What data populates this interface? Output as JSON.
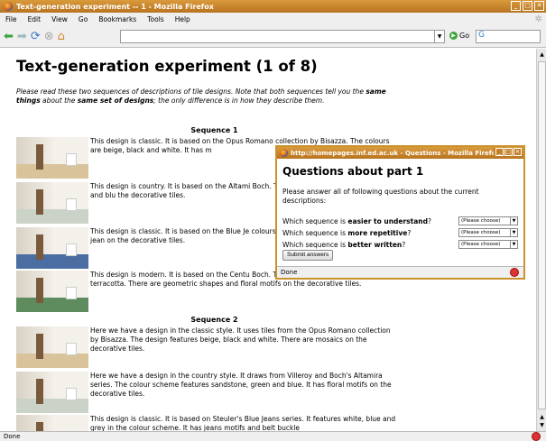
{
  "window": {
    "title": "Text-generation experiment -- 1 - Mozilla Firefox"
  },
  "menu": [
    "File",
    "Edit",
    "View",
    "Go",
    "Bookmarks",
    "Tools",
    "Help"
  ],
  "navbar": {
    "url": "",
    "go_label": "Go",
    "search_placeholder": ""
  },
  "page": {
    "title": "Text-generation experiment (1 of 8)",
    "intro_parts": [
      "Please read these two sequences of descriptions of tile designs. Note that both sequences tell you the ",
      "same things",
      " about the ",
      "same set of designs",
      "; the only difference is in how they describe them."
    ],
    "seq1_heading": "Sequence 1",
    "seq2_heading": "Sequence 2",
    "seq1": [
      "This design is classic. It is based on the Opus Romano collection by Bisazza. The colours are beige, black and white. It has m",
      "This design is country. It is based on the Altami Boch. The colours are sandstone, green and blu the decorative tiles.",
      "This design is classic. It is based on the Blue Je colours are white, blue and grey. There are jean on the decorative tiles.",
      "This design is modern. It is based on the Centu Boch. The colours are blue, white and terracotta. There are geometric shapes and floral motifs on the decorative tiles."
    ],
    "seq2": [
      "Here we have a design in the classic style. It uses tiles from the Opus Romano collection by Bisazza. The design features beige, black and white. There are mosaics on the decorative tiles.",
      "Here we have a design in the country style. It draws from Villeroy and Boch's Altamira series. The colour scheme features sandstone, green and blue. It has floral motifs on the decorative tiles.",
      "This design is classic. It is based on Steuler's Blue Jeans series. It features white, blue and grey in the colour scheme. It has jeans motifs and belt buckle"
    ]
  },
  "popup": {
    "title": "http://homepages.inf.ed.ac.uk - Questions - Mozilla Firefox",
    "heading": "Questions about part 1",
    "intro": "Please answer all of following questions about the current descriptions:",
    "questions": [
      {
        "pre": "Which sequence is ",
        "bold": "easier to understand",
        "post": "?",
        "selected": "(Please choose)"
      },
      {
        "pre": "Which sequence is ",
        "bold": "more repetitive",
        "post": "?",
        "selected": "(Please choose)"
      },
      {
        "pre": "Which sequence is ",
        "bold": "better written",
        "post": "?",
        "selected": "(Please choose)"
      }
    ],
    "submit_label": "Submit answers",
    "status": "Done"
  },
  "status": "Done",
  "colors": {
    "titlebar": "#c9922d",
    "floors": [
      "#d8c39a",
      "#cbd3c9",
      "#4a6ea2",
      "#5e8c5e",
      "#d8c39a",
      "#cbd3c9",
      "#4a6ea2"
    ]
  }
}
